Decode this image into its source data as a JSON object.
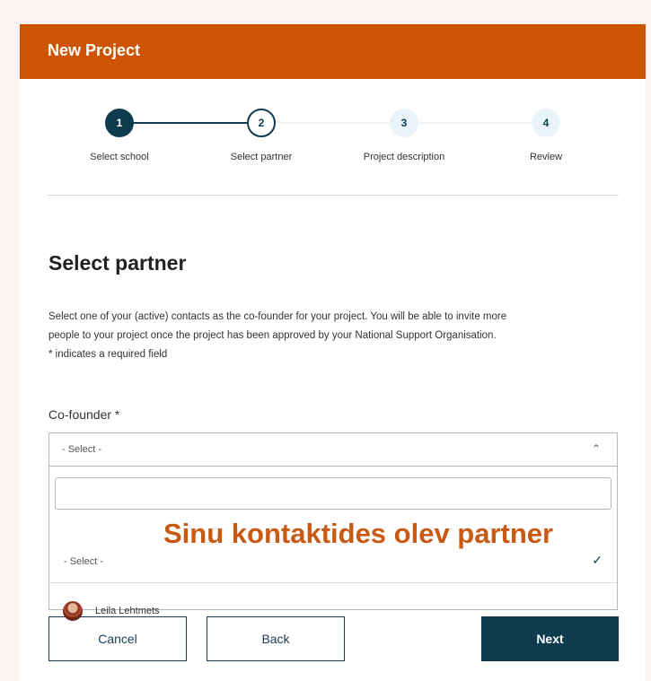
{
  "header": {
    "title": "New Project"
  },
  "stepper": {
    "steps": [
      {
        "number": "1",
        "label": "Select school"
      },
      {
        "number": "2",
        "label": "Select partner"
      },
      {
        "number": "3",
        "label": "Project description"
      },
      {
        "number": "4",
        "label": "Review"
      }
    ],
    "current_step": 2
  },
  "main": {
    "title": "Select partner",
    "description_line1": "Select one of your (active) contacts as the co-founder for your project. You will be able to invite more",
    "description_line2": "people to your project once the project has been approved by your National Support Organisation.",
    "required_note": "* indicates a required field",
    "cofounder_label": "Co-founder *",
    "select_value": "- Select -"
  },
  "dropdown": {
    "search_value": "",
    "options": [
      {
        "label": "- Select -",
        "selected": true
      },
      {
        "label": "Leila Lehtmets",
        "selected": false
      }
    ]
  },
  "annotation": {
    "text": "Sinu kontaktides olev partner"
  },
  "buttons": {
    "cancel": "Cancel",
    "back": "Back",
    "next": "Next"
  },
  "colors": {
    "header": "#cc5402",
    "primary": "#0f3b4f",
    "annotation": "#c85a14",
    "step_inactive_fill": "#e9f3fa"
  },
  "icons": {
    "select_chevron": "chevron-up-icon",
    "selected_check": "check-icon"
  }
}
